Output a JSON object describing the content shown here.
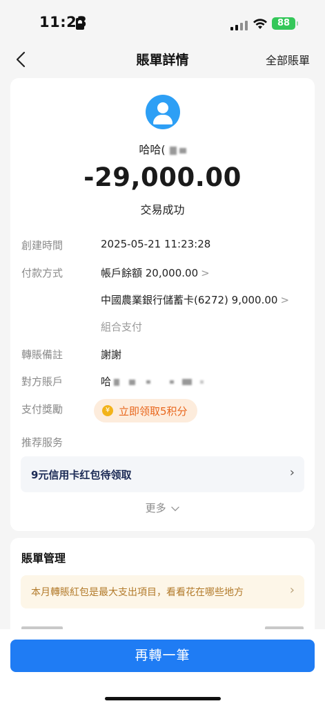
{
  "status_bar": {
    "time": "11:23",
    "battery": "88"
  },
  "nav": {
    "title": "賬單詳情",
    "right_link": "全部賬單",
    "back_icon": "chevron-left-icon"
  },
  "transaction": {
    "payee_prefix": "哈哈(",
    "amount": "-29,000.00",
    "status": "交易成功",
    "avatar_icon": "user-avatar-icon"
  },
  "details": {
    "created_label": "創建時間",
    "created_value": "2025-05-21 11:23:28",
    "payment_label": "付款方式",
    "payment_line1": "帳戶餘額 20,000.00",
    "payment_line2": "中國農業銀行儲蓄卡(6272) 9,000.00",
    "payment_line3": "組合支付",
    "chevron": ">",
    "note_label": "轉賬備註",
    "note_value": "謝謝",
    "account_label": "對方賬戶",
    "account_prefix": "哈",
    "reward_label": "支付獎勵",
    "reward_text": "立即领取5积分",
    "recommend_label": "推荐服务",
    "promo_text": "9元信用卡红包待领取",
    "more_text": "更多"
  },
  "bill_management": {
    "title": "賬單管理",
    "tip_text": "本月轉賬紅包是最大支出項目，看看花在哪些地方"
  },
  "cta": {
    "label": "再轉一筆"
  },
  "colors": {
    "primary_blue": "#1f7cf4",
    "avatar_blue": "#2d9ff5",
    "reward_orange": "#e8661c",
    "battery_green": "#34c759"
  }
}
